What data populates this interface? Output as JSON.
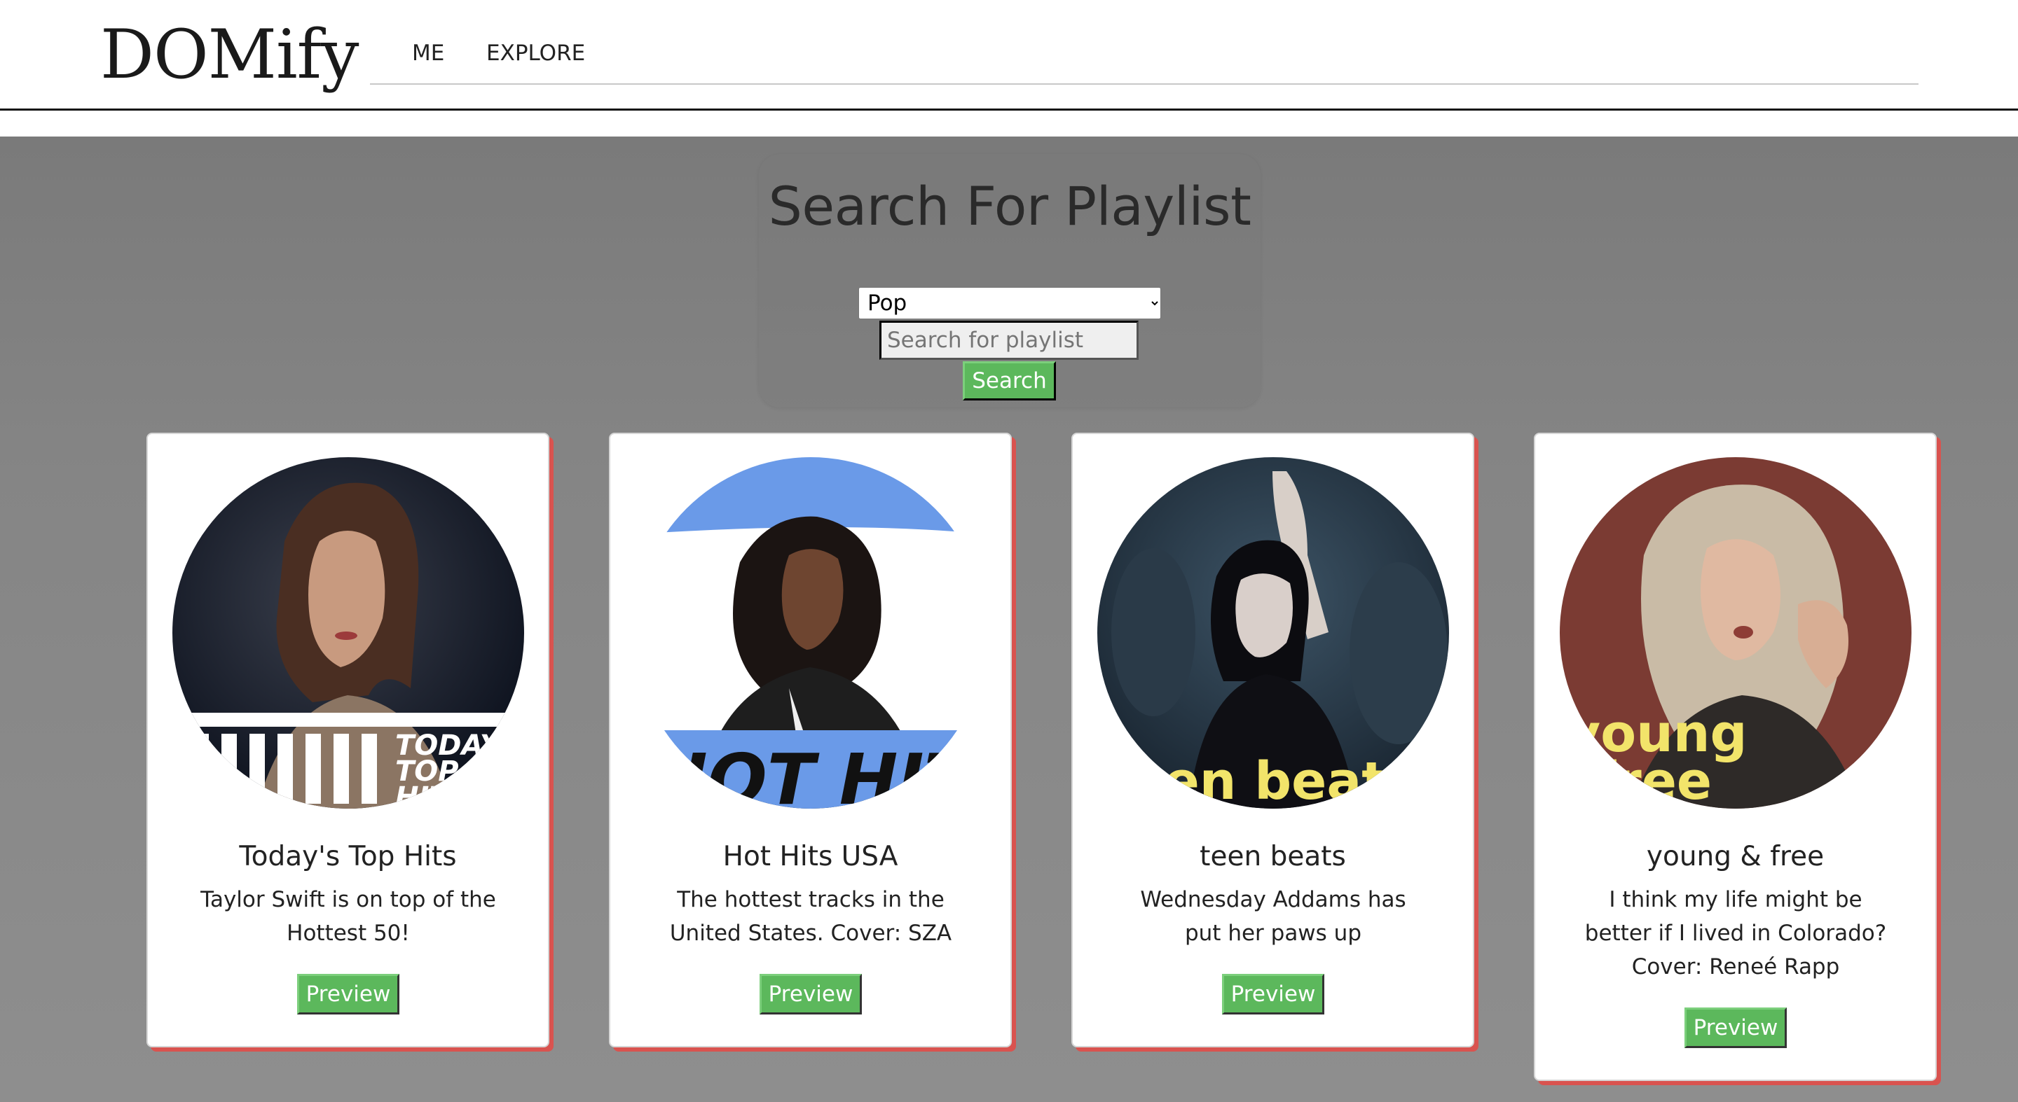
{
  "app": {
    "brand": "DOMify",
    "nav": {
      "me": "ME",
      "explore": "EXPLORE"
    }
  },
  "search": {
    "title": "Search For Playlist",
    "genre_selected": "Pop",
    "placeholder": "Search for playlist",
    "button_label": "Search"
  },
  "playlists": [
    {
      "title": "Today's Top Hits",
      "description": "Taylor Swift is on top of the Hottest 50!",
      "cover_text": "TODAY TOP HITS",
      "preview_label": "Preview"
    },
    {
      "title": "Hot Hits USA",
      "description": "The hottest tracks in the United States. Cover: SZA",
      "cover_text": "HOT HITS",
      "preview_label": "Preview"
    },
    {
      "title": "teen beats",
      "description": "Wednesday Addams has put her paws up",
      "cover_text": "teen beats",
      "preview_label": "Preview"
    },
    {
      "title": "young & free",
      "description": "I think my life might be better if I lived in Colorado? Cover: Reneé Rapp",
      "cover_text_line1": "young",
      "cover_text_line2": "free",
      "preview_label": "Preview"
    }
  ],
  "colors": {
    "accent_button": "#5cb85c",
    "card_shadow": "#d9534f",
    "yellow_cover_text": "#f2e46a",
    "blue_cover": "#6a9ae8"
  }
}
